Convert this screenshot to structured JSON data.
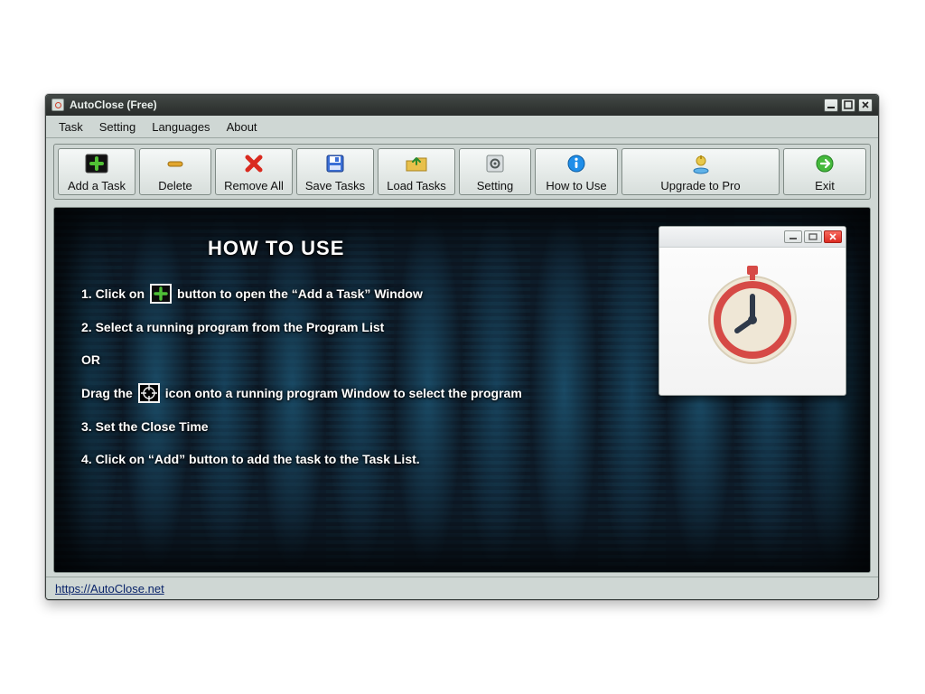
{
  "window": {
    "title": "AutoClose (Free)"
  },
  "menu": {
    "task": "Task",
    "setting": "Setting",
    "languages": "Languages",
    "about": "About"
  },
  "toolbar": {
    "add_task": "Add a Task",
    "delete": "Delete",
    "remove_all": "Remove All",
    "save_tasks": "Save Tasks",
    "load_tasks": "Load Tasks",
    "setting": "Setting",
    "how_to_use": "How to Use",
    "upgrade": "Upgrade to Pro",
    "exit": "Exit"
  },
  "content": {
    "title": "HOW TO USE",
    "step1a": "1. Click on",
    "step1b": "button to open the “Add a Task” Window",
    "step2": "2. Select a running program from the Program List",
    "or": "OR",
    "dragA": "Drag the",
    "dragB": "icon onto a running program Window to select the program",
    "step3": "3. Set the Close Time",
    "step4": "4. Click on “Add” button to add the task to the Task List."
  },
  "footer": {
    "url": "https://AutoClose.net"
  }
}
